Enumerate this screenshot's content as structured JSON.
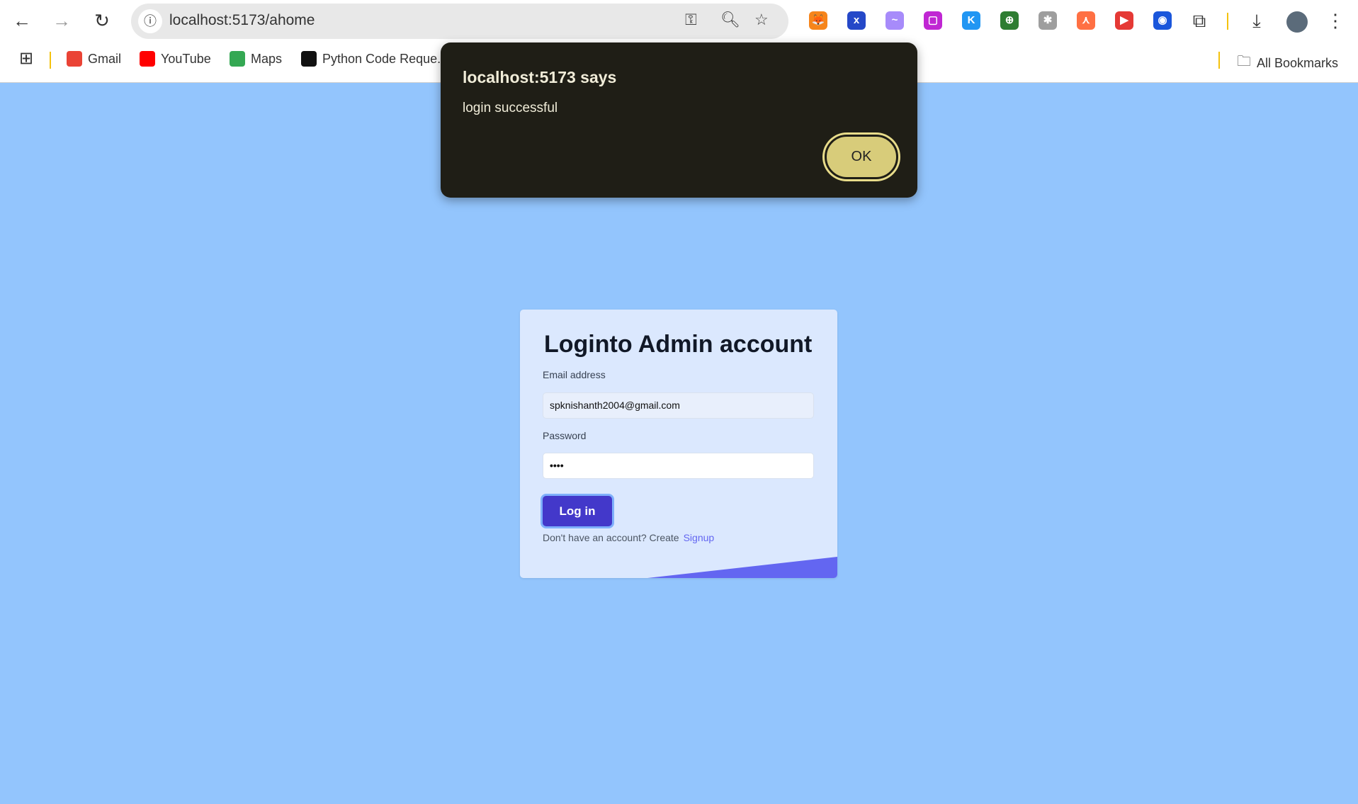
{
  "browser": {
    "url": "localhost:5173/ahome",
    "bookmarks": [
      {
        "label": "Gmail",
        "color": "#ea4335"
      },
      {
        "label": "YouTube",
        "color": "#ff0000"
      },
      {
        "label": "Maps",
        "color": "#34a853"
      },
      {
        "label": "Python Code Reque...",
        "color": "#111111"
      }
    ],
    "all_bookmarks": "All Bookmarks",
    "extensions": [
      {
        "glyph": "🦊",
        "color": "#f6851b"
      },
      {
        "glyph": "x",
        "color": "#2548c8"
      },
      {
        "glyph": "~",
        "color": "#a78bfa"
      },
      {
        "glyph": "▢",
        "color": "#c026d3"
      },
      {
        "glyph": "K",
        "color": "#2196f3"
      },
      {
        "glyph": "⊕",
        "color": "#2e7d32"
      },
      {
        "glyph": "✱",
        "color": "#9e9e9e"
      },
      {
        "glyph": "⋏",
        "color": "#ff7043"
      },
      {
        "glyph": "▶",
        "color": "#e53935"
      },
      {
        "glyph": "◉",
        "color": "#1a56db"
      }
    ]
  },
  "dialog": {
    "title": "localhost:5173 says",
    "message": "login successful",
    "ok_label": "OK"
  },
  "login": {
    "heading": "Loginto Admin account",
    "email_label": "Email address",
    "email_value": "spknishanth2004@gmail.com",
    "password_label": "Password",
    "password_value": "••••",
    "submit_label": "Log in",
    "footer_text": "Don't have an account? Create",
    "signup_link": "Signup",
    "accent": "#4338ca",
    "wedge_color": "#6366f1",
    "background": "#93c5fd"
  }
}
